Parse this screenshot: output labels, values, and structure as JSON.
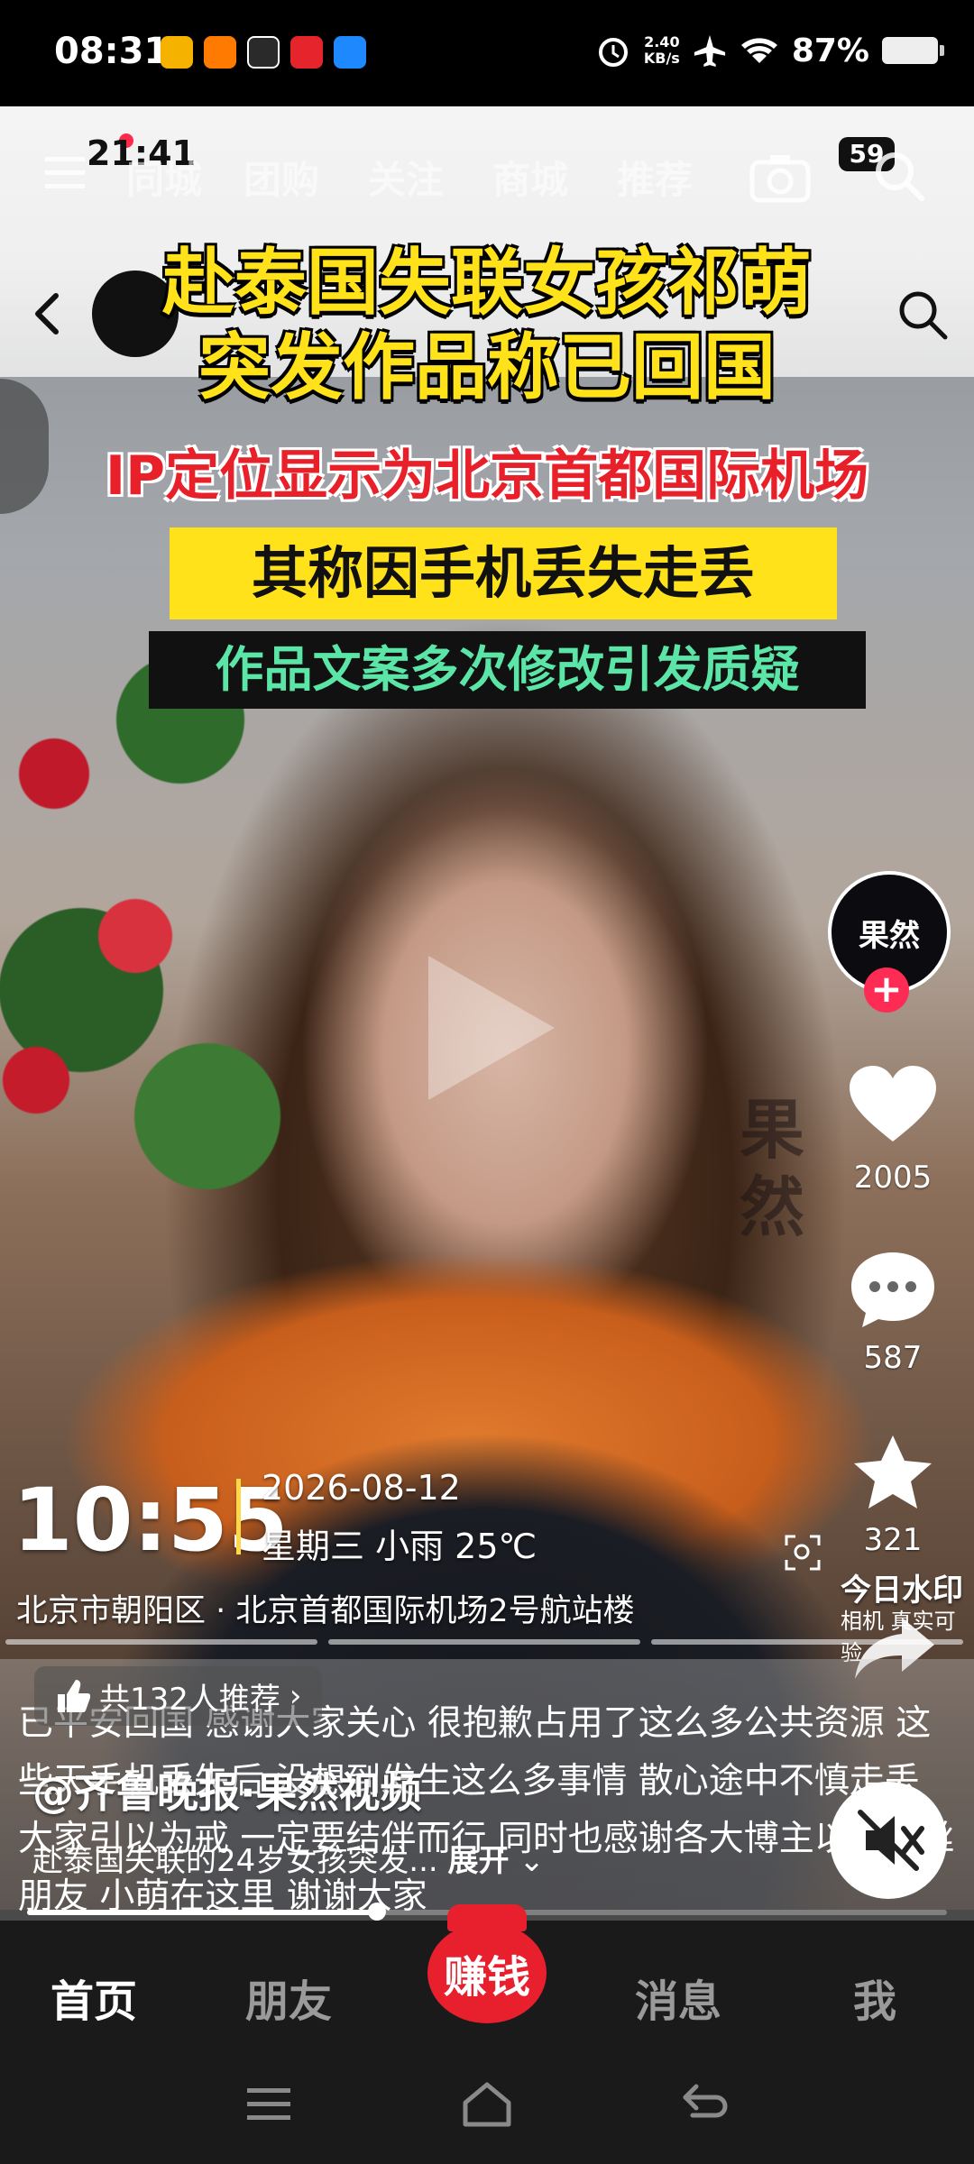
{
  "status_bar": {
    "time": "08:31",
    "net_speed_value": "2.40",
    "net_speed_unit": "KB/s",
    "battery": "87%"
  },
  "screen_overlay": {
    "time": "21:41",
    "tabs": [
      "同城",
      "团购",
      "关注",
      "商城",
      "推荐"
    ],
    "battery": "59"
  },
  "headline": {
    "line1": "赴泰国失联女孩祁萌",
    "line2": "突发作品称已回国",
    "line3": "IP定位显示为北京首都国际机场",
    "line4": "其称因手机丢失走丢",
    "line5": "作品文案多次修改引发质疑"
  },
  "creator": {
    "avatar_text": "果然",
    "watermark": "果然",
    "likes": "2005",
    "comments": "587",
    "favorites": "321"
  },
  "photo_watermark": {
    "time": "10:55",
    "date": "2026-08-12",
    "weather": "星期三 小雨 25℃",
    "location": "北京市朝阳区 · 北京首都国际机场2号航站楼",
    "brand": "今日水印",
    "brand_sub": "相机 真实可验"
  },
  "caption": {
    "text": "已平安回国 感谢大家关心 很抱歉占用了这么多公共资源 这些天手机丢失后 没想到发生这么多事情 散心途中不慎走丢 大家引以为戒 一定要结伴而行 同时也感谢各大博主以及粉丝朋友 小萌在这里 谢谢大家",
    "recommend": "共132人推荐",
    "author": "@齐鲁晚报·果然视频",
    "desc": "赴泰国失联的24岁女孩突发...",
    "expand": "展开"
  },
  "playback": {
    "progress": 0.38
  },
  "bottom_nav": {
    "items": [
      "首页",
      "朋友",
      "消息",
      "我"
    ],
    "earn": "赚钱"
  },
  "colors": {
    "headline_yellow": "#ffe21a",
    "headline_red": "#e8202a",
    "headline_green": "#5be6a8",
    "follow_red": "#fe2c55"
  }
}
